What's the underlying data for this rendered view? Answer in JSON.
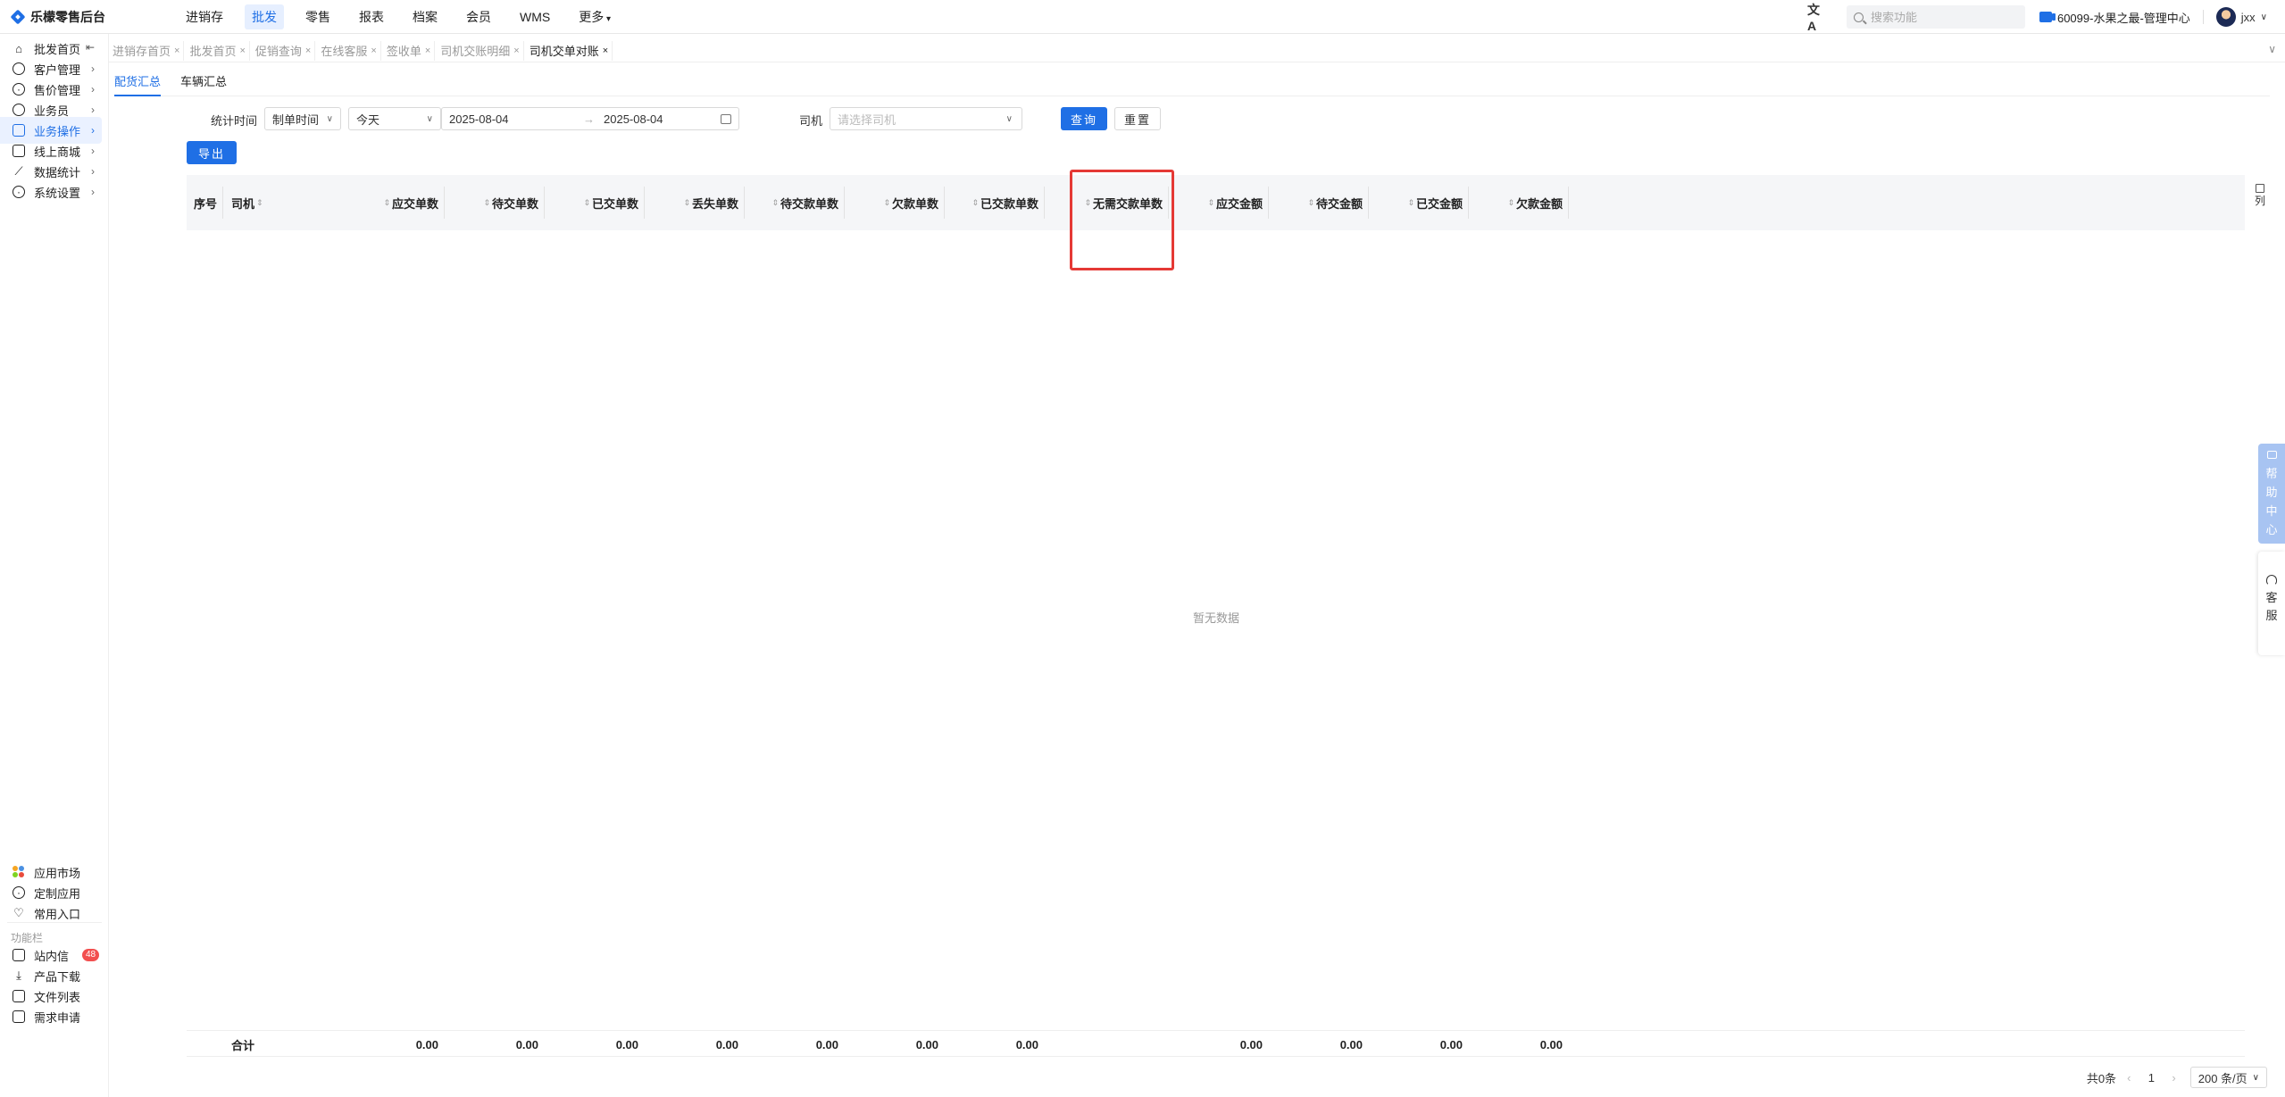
{
  "app": {
    "title": "乐檬零售后台"
  },
  "top_nav": {
    "items": [
      {
        "label": "进销存",
        "active": false
      },
      {
        "label": "批发",
        "active": true
      },
      {
        "label": "零售",
        "active": false
      },
      {
        "label": "报表",
        "active": false
      },
      {
        "label": "档案",
        "active": false
      },
      {
        "label": "会员",
        "active": false
      },
      {
        "label": "WMS",
        "active": false
      }
    ],
    "more_label": "更多",
    "translate_icon": "文A",
    "search_placeholder": "搜索功能",
    "store": "60099-水果之最-管理中心",
    "user": "jxx"
  },
  "sidebar": {
    "items": [
      {
        "label": "批发首页",
        "icon": "home-icon"
      },
      {
        "label": "客户管理",
        "icon": "user-icon"
      },
      {
        "label": "售价管理",
        "icon": "price-icon"
      },
      {
        "label": "业务员",
        "icon": "person-icon"
      },
      {
        "label": "业务操作",
        "icon": "operation-icon",
        "active": true
      },
      {
        "label": "线上商城",
        "icon": "store-icon"
      },
      {
        "label": "数据统计",
        "icon": "chart-icon"
      },
      {
        "label": "系统设置",
        "icon": "settings-icon"
      }
    ],
    "bottom": [
      {
        "label": "应用市场"
      },
      {
        "label": "定制应用"
      },
      {
        "label": "常用入口"
      }
    ],
    "section_label": "功能栏",
    "function_items": [
      {
        "label": "站内信",
        "badge": "48"
      },
      {
        "label": "产品下载"
      },
      {
        "label": "文件列表"
      },
      {
        "label": "需求申请"
      }
    ]
  },
  "tabs": [
    {
      "label": "进销存首页"
    },
    {
      "label": "批发首页"
    },
    {
      "label": "促销查询"
    },
    {
      "label": "在线客服"
    },
    {
      "label": "签收单"
    },
    {
      "label": "司机交账明细"
    },
    {
      "label": "司机交单对账",
      "active": true
    }
  ],
  "subtabs": [
    {
      "label": "配货汇总",
      "active": true
    },
    {
      "label": "车辆汇总"
    }
  ],
  "filters": {
    "time_label": "统计时间",
    "time_type": "制单时间",
    "period": "今天",
    "start_date": "2025-08-04",
    "end_date": "2025-08-04",
    "range_arrow": "→",
    "driver_label": "司机",
    "driver_placeholder": "请选择司机",
    "query_button": "查询",
    "reset_button": "重置"
  },
  "export_button": "导出",
  "table": {
    "columns": [
      "序号",
      "司机",
      "应交单数",
      "待交单数",
      "已交单数",
      "丢失单数",
      "待交款单数",
      "欠款单数",
      "已交款单数",
      "无需交款单数",
      "应交金额",
      "待交金额",
      "已交金额",
      "欠款金额"
    ],
    "column_setting": "列",
    "empty_text": "暂无数据",
    "footer": {
      "label": "合计",
      "values": [
        "0.00",
        "0.00",
        "0.00",
        "0.00",
        "0.00",
        "0.00",
        "0.00",
        "",
        "0.00",
        "0.00",
        "0.00",
        "0.00"
      ]
    }
  },
  "pagination": {
    "total": "共0条",
    "current_page": "1",
    "page_size": "200 条/页"
  },
  "floating": {
    "help_center": [
      "帮",
      "助",
      "中",
      "心"
    ],
    "customer_service": [
      "客",
      "服"
    ]
  },
  "colors": {
    "accent": "#1f6fe5",
    "highlight": "#e53935",
    "badge": "#f24f4f"
  }
}
